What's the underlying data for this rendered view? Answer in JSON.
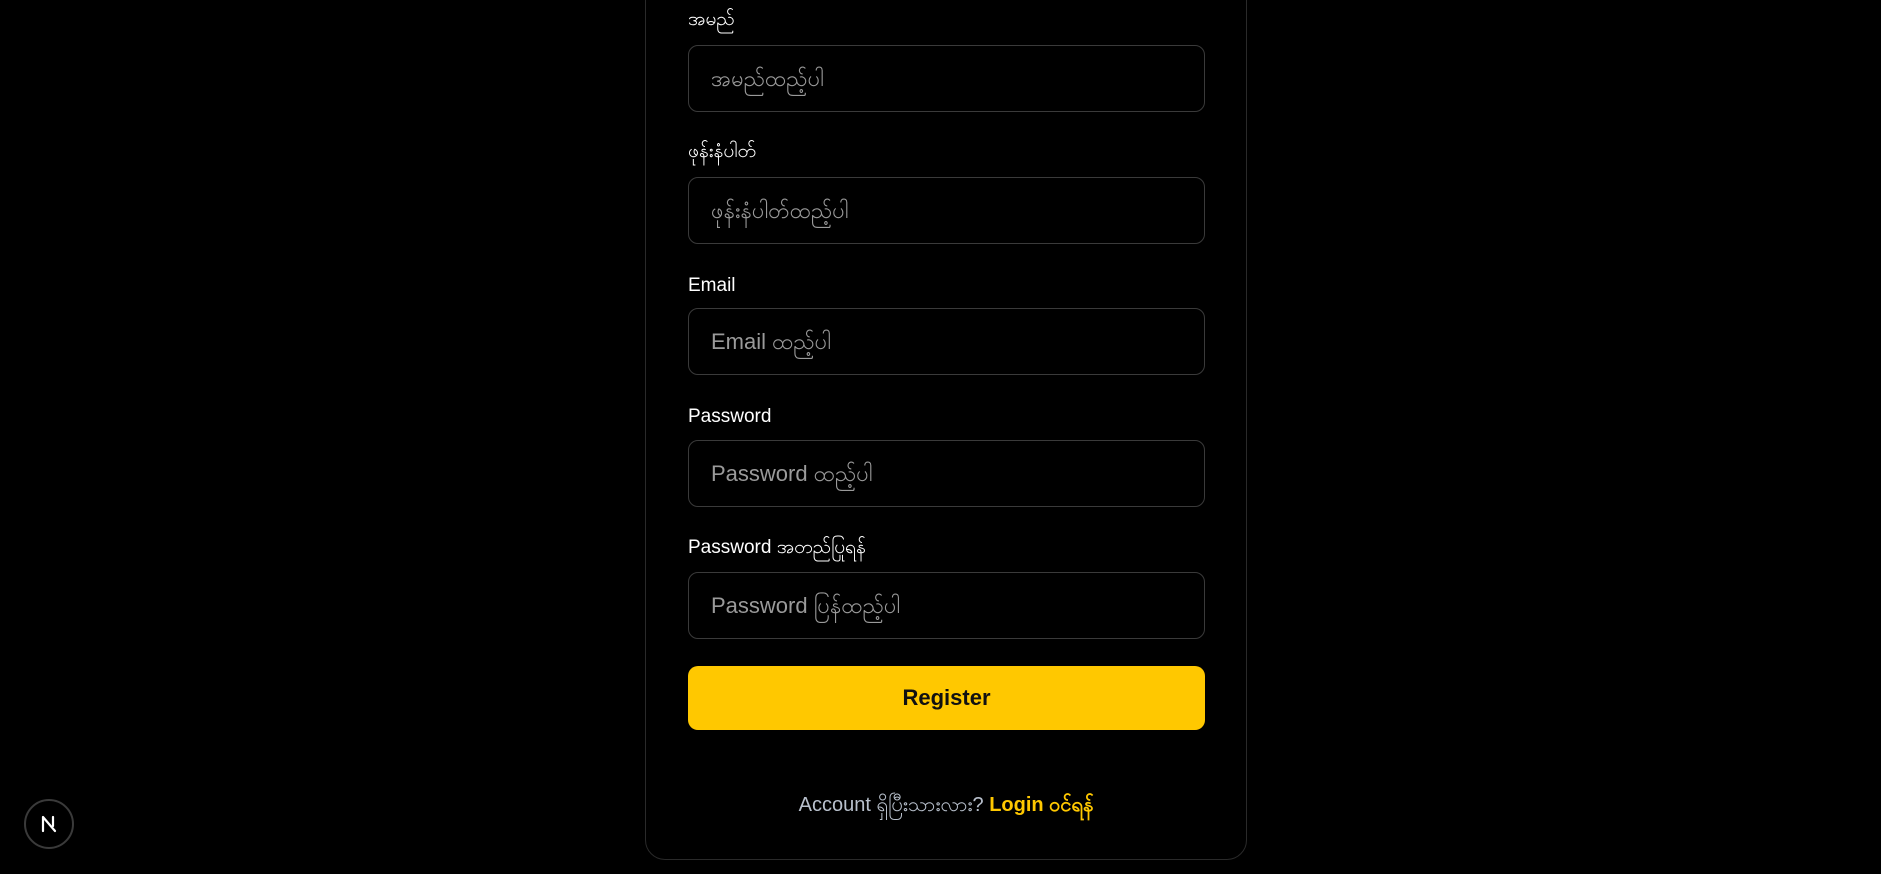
{
  "form": {
    "fields": [
      {
        "label": "အမည်",
        "placeholder": "အမည်ထည့်ပါ",
        "value": ""
      },
      {
        "label": "ဖုန်းနံပါတ်",
        "placeholder": "ဖုန်းနံပါတ်ထည့်ပါ",
        "value": ""
      },
      {
        "label": "Email",
        "placeholder": "Email ထည့်ပါ",
        "value": ""
      },
      {
        "label": "Password",
        "placeholder": "Password ထည့်ပါ",
        "value": ""
      },
      {
        "label": "Password အတည်ပြုရန်",
        "placeholder": "Password ပြန်ထည့်ပါ",
        "value": ""
      }
    ],
    "submit_label": "Register"
  },
  "footer": {
    "prompt": "Account ရှိပြီးသားလား? ",
    "link_label": "Login ဝင်ရန်"
  },
  "badge": {
    "icon": "nextjs-icon"
  },
  "colors": {
    "background": "#000000",
    "accent": "#ffc800",
    "input_border": "#3a3a3a",
    "placeholder": "#9a9a9a",
    "footer_prompt": "#b8c0cc"
  }
}
